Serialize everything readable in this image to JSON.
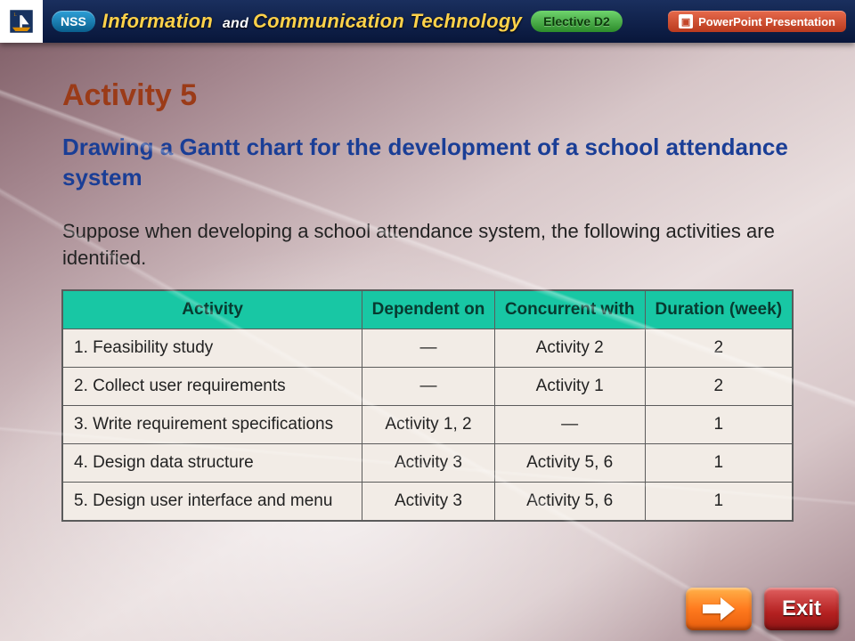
{
  "banner": {
    "nss": "NSS",
    "title_italic": "Information",
    "title_and": " and ",
    "title_rest": "Communication Technology",
    "elective": "Elective D2",
    "pp_badge": "PowerPoint Presentation"
  },
  "page": {
    "h1": "Activity 5",
    "h2": "Drawing a Gantt chart for the development of a school attendance system",
    "lead": "Suppose when developing a school attendance system, the following activities are identified."
  },
  "table": {
    "headers": [
      "Activity",
      "Dependent on",
      "Concurrent with",
      "Duration (week)"
    ],
    "rows": [
      {
        "activity": "1. Feasibility study",
        "dep": "—",
        "conc": "Activity 2",
        "dur": "2"
      },
      {
        "activity": "2. Collect user requirements",
        "dep": "—",
        "conc": "Activity 1",
        "dur": "2"
      },
      {
        "activity": "3. Write requirement specifications",
        "dep": "Activity 1, 2",
        "conc": "—",
        "dur": "1"
      },
      {
        "activity": "4. Design data structure",
        "dep": "Activity 3",
        "conc": "Activity 5, 6",
        "dur": "1"
      },
      {
        "activity": "5. Design user interface and menu",
        "dep": "Activity 3",
        "conc": "Activity 5, 6",
        "dur": "1"
      }
    ]
  },
  "buttons": {
    "exit": "Exit"
  }
}
